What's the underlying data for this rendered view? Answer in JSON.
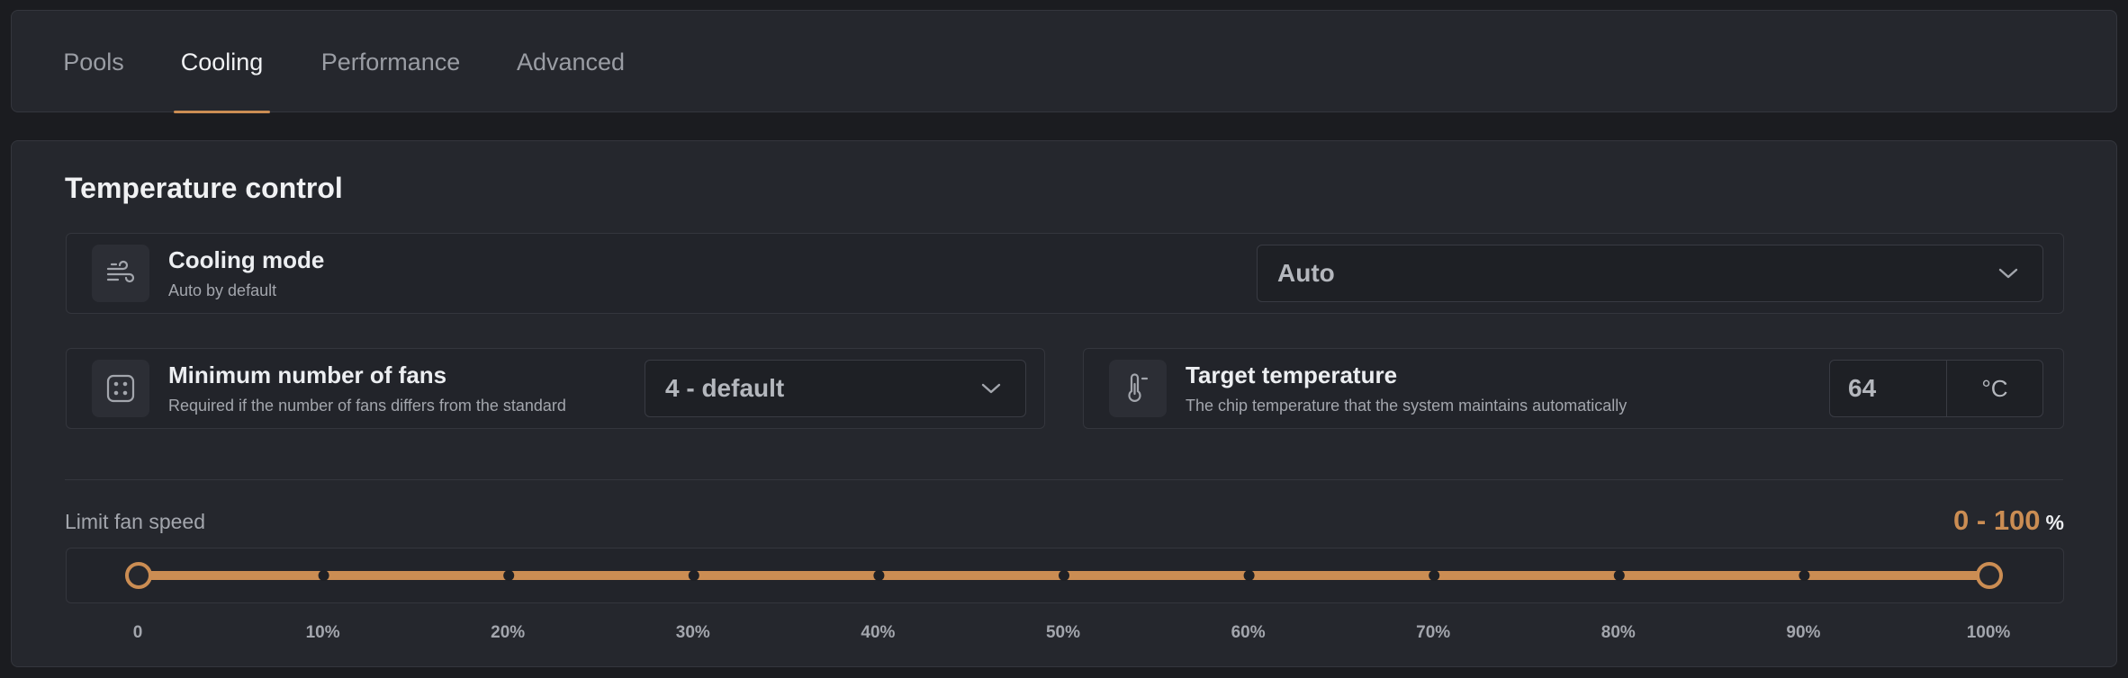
{
  "tabs": [
    {
      "label": "Pools",
      "active": false
    },
    {
      "label": "Cooling",
      "active": true
    },
    {
      "label": "Performance",
      "active": false
    },
    {
      "label": "Advanced",
      "active": false
    }
  ],
  "section": {
    "title": "Temperature control"
  },
  "cooling_mode": {
    "title": "Cooling mode",
    "subtitle": "Auto by default",
    "value": "Auto",
    "icon": "wind-icon"
  },
  "min_fans": {
    "title": "Minimum number of fans",
    "subtitle": "Required if the number of fans differs from the standard",
    "value": "4 - default",
    "icon": "fan-dots-icon"
  },
  "target_temp": {
    "title": "Target temperature",
    "subtitle": "The chip temperature that the system maintains automatically",
    "value": "64",
    "unit": "°C",
    "icon": "thermometer-icon"
  },
  "fan_limit": {
    "label": "Limit fan speed",
    "range_text": "0 - 100",
    "unit": "%",
    "min": 0,
    "max": 100,
    "ticks": [
      "0",
      "10%",
      "20%",
      "30%",
      "40%",
      "50%",
      "60%",
      "70%",
      "80%",
      "90%",
      "100%"
    ]
  },
  "colors": {
    "accent": "#cb8d53",
    "background": "#1b1c20",
    "card": "#25272d"
  }
}
